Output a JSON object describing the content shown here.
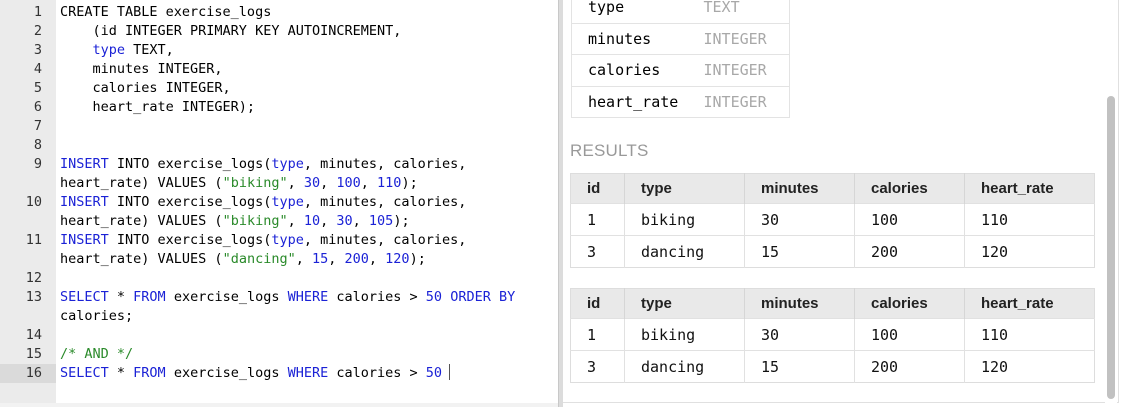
{
  "editor": {
    "active_line": "16",
    "lines": [
      {
        "n": "1",
        "t": [
          [
            "",
            "CREATE TABLE exercise_logs"
          ]
        ]
      },
      {
        "n": "2",
        "t": [
          [
            "",
            "    (id INTEGER PRIMARY KEY AUTOINCREMENT,"
          ]
        ]
      },
      {
        "n": "3",
        "t": [
          [
            "",
            "    "
          ],
          [
            "kw",
            "type"
          ],
          [
            "",
            " TEXT,"
          ]
        ]
      },
      {
        "n": "4",
        "t": [
          [
            "",
            "    minutes INTEGER,"
          ]
        ]
      },
      {
        "n": "5",
        "t": [
          [
            "",
            "    calories INTEGER,"
          ]
        ]
      },
      {
        "n": "6",
        "t": [
          [
            "",
            "    heart_rate INTEGER);"
          ]
        ]
      },
      {
        "n": "7",
        "t": [
          [
            "",
            ""
          ]
        ]
      },
      {
        "n": "8",
        "t": [
          [
            "",
            ""
          ]
        ]
      },
      {
        "n": "9",
        "t": [
          [
            "kw",
            "INSERT"
          ],
          [
            "",
            " INTO exercise_logs("
          ],
          [
            "kw",
            "type"
          ],
          [
            "",
            ", minutes, calories,"
          ]
        ]
      },
      {
        "n": "",
        "t": [
          [
            "",
            "heart_rate) VALUES ("
          ],
          [
            "str",
            "\"biking\""
          ],
          [
            "",
            ", "
          ],
          [
            "kw",
            "30"
          ],
          [
            "",
            ", "
          ],
          [
            "kw",
            "100"
          ],
          [
            "",
            ", "
          ],
          [
            "kw",
            "110"
          ],
          [
            "",
            ");"
          ]
        ]
      },
      {
        "n": "10",
        "t": [
          [
            "kw",
            "INSERT"
          ],
          [
            "",
            " INTO exercise_logs("
          ],
          [
            "kw",
            "type"
          ],
          [
            "",
            ", minutes, calories,"
          ]
        ]
      },
      {
        "n": "",
        "t": [
          [
            "",
            "heart_rate) VALUES ("
          ],
          [
            "str",
            "\"biking\""
          ],
          [
            "",
            ", "
          ],
          [
            "kw",
            "10"
          ],
          [
            "",
            ", "
          ],
          [
            "kw",
            "30"
          ],
          [
            "",
            ", "
          ],
          [
            "kw",
            "105"
          ],
          [
            "",
            ");"
          ]
        ]
      },
      {
        "n": "11",
        "t": [
          [
            "kw",
            "INSERT"
          ],
          [
            "",
            " INTO exercise_logs("
          ],
          [
            "kw",
            "type"
          ],
          [
            "",
            ", minutes, calories,"
          ]
        ]
      },
      {
        "n": "",
        "t": [
          [
            "",
            "heart_rate) VALUES ("
          ],
          [
            "str",
            "\"dancing\""
          ],
          [
            "",
            ", "
          ],
          [
            "kw",
            "15"
          ],
          [
            "",
            ", "
          ],
          [
            "kw",
            "200"
          ],
          [
            "",
            ", "
          ],
          [
            "kw",
            "120"
          ],
          [
            "",
            ");"
          ]
        ]
      },
      {
        "n": "12",
        "t": [
          [
            "",
            ""
          ]
        ]
      },
      {
        "n": "13",
        "t": [
          [
            "kw",
            "SELECT"
          ],
          [
            "",
            " * "
          ],
          [
            "kw",
            "FROM"
          ],
          [
            "",
            " exercise_logs "
          ],
          [
            "kw",
            "WHERE"
          ],
          [
            "",
            " calories > "
          ],
          [
            "kw",
            "50"
          ],
          [
            "",
            " "
          ],
          [
            "kw",
            "ORDER BY"
          ]
        ]
      },
      {
        "n": "",
        "t": [
          [
            "",
            "calories;"
          ]
        ]
      },
      {
        "n": "14",
        "t": [
          [
            "",
            ""
          ]
        ]
      },
      {
        "n": "15",
        "t": [
          [
            "com",
            "/* AND */"
          ]
        ]
      },
      {
        "n": "16",
        "t": [
          [
            "kw",
            "SELECT"
          ],
          [
            "",
            " * "
          ],
          [
            "kw",
            "FROM"
          ],
          [
            "",
            " exercise_logs "
          ],
          [
            "kw",
            "WHERE"
          ],
          [
            "",
            " calories > "
          ],
          [
            "kw",
            "50"
          ]
        ],
        "cursor": true
      }
    ]
  },
  "schema": {
    "rows": [
      {
        "name": "type",
        "type": "TEXT"
      },
      {
        "name": "minutes",
        "type": "INTEGER"
      },
      {
        "name": "calories",
        "type": "INTEGER"
      },
      {
        "name": "heart_rate",
        "type": "INTEGER"
      }
    ]
  },
  "results": {
    "heading": "RESULTS",
    "tables": [
      {
        "columns": [
          "id",
          "type",
          "minutes",
          "calories",
          "heart_rate"
        ],
        "rows": [
          [
            "1",
            "biking",
            "30",
            "100",
            "110"
          ],
          [
            "3",
            "dancing",
            "15",
            "200",
            "120"
          ]
        ]
      },
      {
        "columns": [
          "id",
          "type",
          "minutes",
          "calories",
          "heart_rate"
        ],
        "rows": [
          [
            "1",
            "biking",
            "30",
            "100",
            "110"
          ],
          [
            "3",
            "dancing",
            "15",
            "200",
            "120"
          ]
        ]
      }
    ]
  }
}
